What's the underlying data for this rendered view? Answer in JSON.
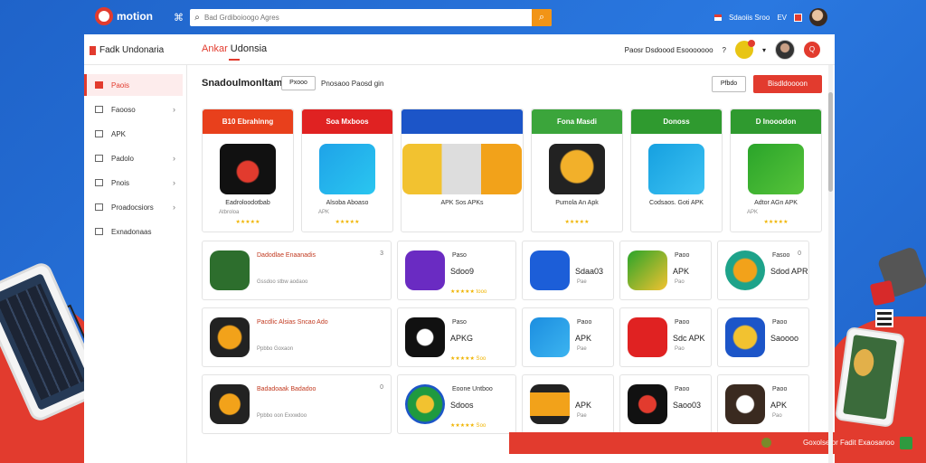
{
  "topbar": {
    "brand": "motion",
    "search_placeholder": "Bad Grdiboioogo Agres",
    "right_label": "Sdaoiis Sroo",
    "lang": "EV"
  },
  "header": {
    "left": "Fadk Undonaria",
    "center_red": "Ankar",
    "center_rest": " Udonsia",
    "right_text": "Paosr Dsdoood Esooooooo",
    "badge": "Q"
  },
  "sidebar": {
    "items": [
      {
        "label": "Paois"
      },
      {
        "label": "Faooso"
      },
      {
        "label": "APK"
      },
      {
        "label": "Padolo"
      },
      {
        "label": "Pnois"
      },
      {
        "label": "Proadocsiors"
      },
      {
        "label": "Exnadonaas"
      }
    ]
  },
  "content": {
    "title": "Snadoulmonltam",
    "filter": "Pxooo",
    "subtitle": "Pnosaoo Paosd gin",
    "sort": "Pfbdo",
    "cta": "Bisdldoooon"
  },
  "featured": [
    {
      "band": "B10 Ebrahinng",
      "name": "Eadroloodotbab",
      "sub": "Atbroloa",
      "stars": "★★★★★"
    },
    {
      "band": "Soa Mxboos",
      "name": "Alsoba Aboaso",
      "sub": "APK",
      "stars": "★★★★★"
    },
    {
      "band": "",
      "name": "APK Sos APKs",
      "sub": "",
      "stars": ""
    },
    {
      "band": "Fona Masdi",
      "name": "Pumola An Apk",
      "sub": "",
      "stars": "★★★★★"
    },
    {
      "band": "Donoss",
      "name": "Codsaos. Goti APK",
      "sub": "",
      "stars": ""
    },
    {
      "band": "D Inooodon",
      "name": "Adtor AGn APK",
      "sub": "APK",
      "stars": "★★★★★"
    }
  ],
  "grid_rows": [
    [
      {
        "title": "Dadodlae Enaanadis",
        "main": "",
        "meta": "Gssdoo stbw aodaoo",
        "stars": "",
        "corner": "3"
      },
      {
        "title": "Paso",
        "main": "Sdoo9",
        "meta": "",
        "stars": "★★★★★ tooo",
        "corner": ""
      },
      {
        "title": "",
        "main": "Sdaa03",
        "meta": "Pae",
        "stars": "",
        "corner": ""
      },
      {
        "title": "Paoo",
        "main": "APK",
        "meta": "Pao",
        "stars": "",
        "corner": ""
      },
      {
        "title": "Fasoo",
        "main": "Sdod APR",
        "meta": "",
        "stars": "",
        "corner": "0"
      }
    ],
    [
      {
        "title": "Pacdlic Alsias Sncao Ado",
        "main": "",
        "meta": "Ppbbo Goxaon",
        "stars": "",
        "corner": ""
      },
      {
        "title": "Paso",
        "main": "APKG",
        "meta": "",
        "stars": "★★★★★ Soo",
        "corner": ""
      },
      {
        "title": "Paoo",
        "main": "APK",
        "meta": "Pae",
        "stars": "",
        "corner": ""
      },
      {
        "title": "Paoo",
        "main": "Sdc APK",
        "meta": "Pao",
        "stars": "",
        "corner": ""
      },
      {
        "title": "Paoo",
        "main": "Saoooo",
        "meta": "",
        "stars": "",
        "corner": ""
      }
    ],
    [
      {
        "title": "Badadoaak Badadoo",
        "main": "",
        "meta": "Ppbbo oon Exxwdoo",
        "stars": "",
        "corner": "0"
      },
      {
        "title": "Eoone Untboo",
        "main": "Sdoos",
        "meta": "",
        "stars": "★★★★★ Soo",
        "corner": ""
      },
      {
        "title": "",
        "main": "APK",
        "meta": "Pae",
        "stars": "",
        "corner": ""
      },
      {
        "title": "Paoo",
        "main": "Saoo03",
        "meta": "",
        "stars": "",
        "corner": ""
      },
      {
        "title": "Paoo",
        "main": "APK",
        "meta": "Pao",
        "stars": "",
        "corner": ""
      }
    ]
  ],
  "toast": {
    "text": "Goxolse or Fadit Exaosanoo"
  }
}
